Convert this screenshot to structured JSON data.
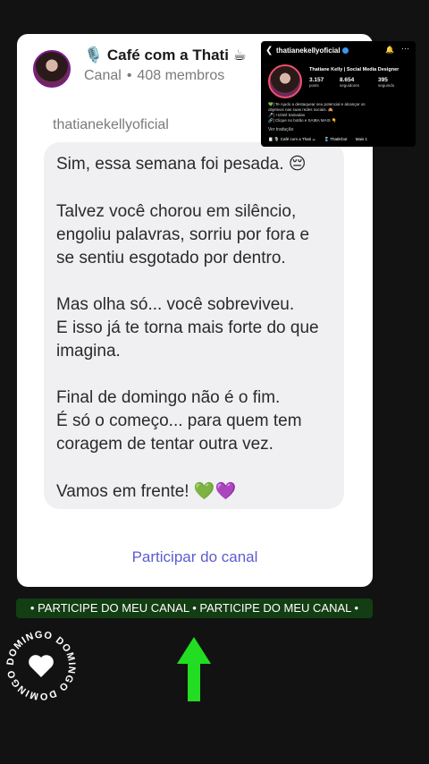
{
  "channel": {
    "title": "🎙️ Café com a Thati ☕",
    "type": "Canal",
    "members": "408 membros"
  },
  "message": {
    "sender": "thatianekellyoficial",
    "lines": [
      "Sim, essa semana foi pesada. 😔",
      "Talvez você chorou em silêncio,",
      "engoliu palavras, sorriu por fora e",
      "se sentiu esgotado por dentro.",
      "Mas olha só... você sobreviveu.",
      "E isso já te torna mais forte do que",
      "imagina.",
      "Final de domingo não é o fim.",
      "É só o começo... para quem tem",
      "coragem de tentar outra vez.",
      "Vamos em frente! 💚💜"
    ]
  },
  "join_label": "Participar do canal",
  "instagram": {
    "back_icon": "chevron-left-icon",
    "username": "thatianekellyoficial",
    "display_name": "Thatiane Kelly | Social Media Designer",
    "stats": [
      {
        "value": "3.157",
        "label": "posts"
      },
      {
        "value": "8.654",
        "label": "seguidores"
      },
      {
        "value": "395",
        "label": "seguindo"
      }
    ],
    "bio_lines": [
      "💚| Te Ajudo a destaquear seu potencial e alcançar os",
      "objetivos nas suas redes sociais. 🙈",
      "🎤| +10mil trainadas",
      "🔗| Clique no botão e SAIBA MAIS 👇"
    ],
    "translate": "Ver tradução",
    "links": [
      "📋 🎙️ Café com a Thati ☕",
      "🧵 ThatiKbot",
      "Mais 1"
    ]
  },
  "banner_text": "• PARTICIPE DO MEU CANAL • PARTICIPE DO MEU CANAL •",
  "stamp_text": "DOMINGO DOMINGO DOMINGO",
  "colors": {
    "background": "#121212",
    "banner": "#133d13",
    "arrow": "#22dd22",
    "link": "#5c5cd0"
  }
}
